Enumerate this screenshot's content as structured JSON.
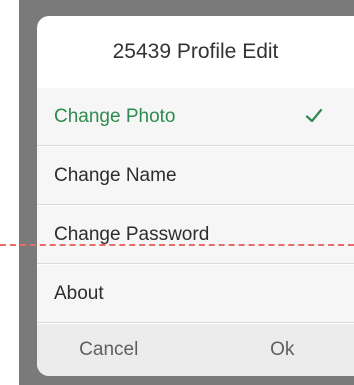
{
  "dialog": {
    "title": "25439 Profile Edit",
    "options": [
      {
        "label": "Change Photo",
        "selected": true
      },
      {
        "label": "Change Name",
        "selected": false
      },
      {
        "label": "Change Password",
        "selected": false
      },
      {
        "label": "About",
        "selected": false
      }
    ],
    "cancel_label": "Cancel",
    "ok_label": "Ok"
  },
  "colors": {
    "accent": "#2e8b4f",
    "backdrop": "#7a7a7a",
    "guide_line": "#ea6a6a"
  },
  "icons": {
    "selected": "check-icon"
  }
}
